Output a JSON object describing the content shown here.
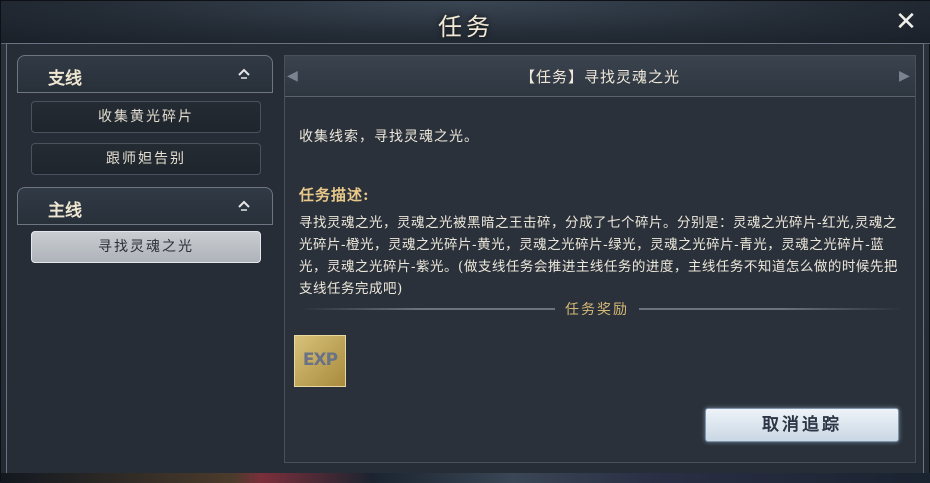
{
  "window": {
    "title": "任务",
    "close_icon": "close-icon"
  },
  "sidebar": {
    "categories": [
      {
        "label": "支线",
        "icon": "chevron-up-icon",
        "items": [
          {
            "label": "收集黄光碎片"
          },
          {
            "label": "跟师妲告别"
          }
        ]
      },
      {
        "label": "主线",
        "icon": "chevron-up-icon",
        "items": [
          {
            "label": "寻找灵魂之光",
            "selected": true
          }
        ]
      }
    ]
  },
  "quest": {
    "title": "【任务】寻找灵魂之光",
    "objective": "收集线索，寻找灵魂之光。",
    "desc_title": "任务描述:",
    "description": "寻找灵魂之光，灵魂之光被黑暗之王击碎，分成了七个碎片。分别是：灵魂之光碎片-红光,灵魂之光碎片-橙光，灵魂之光碎片-黄光，灵魂之光碎片-绿光，灵魂之光碎片-青光，灵魂之光碎片-蓝光，灵魂之光碎片-紫光。(做支线任务会推进主线任务的进度，主线任务不知道怎么做的时候先把支线任务完成吧)",
    "reward_title": "任务奖励",
    "reward_exp_label": "EXP",
    "cancel_button": "取消追踪"
  },
  "colors": {
    "accent_gold": "#e9c98a",
    "button_bg": "#dfe8f1",
    "selected_item": "#c0c5cb"
  }
}
